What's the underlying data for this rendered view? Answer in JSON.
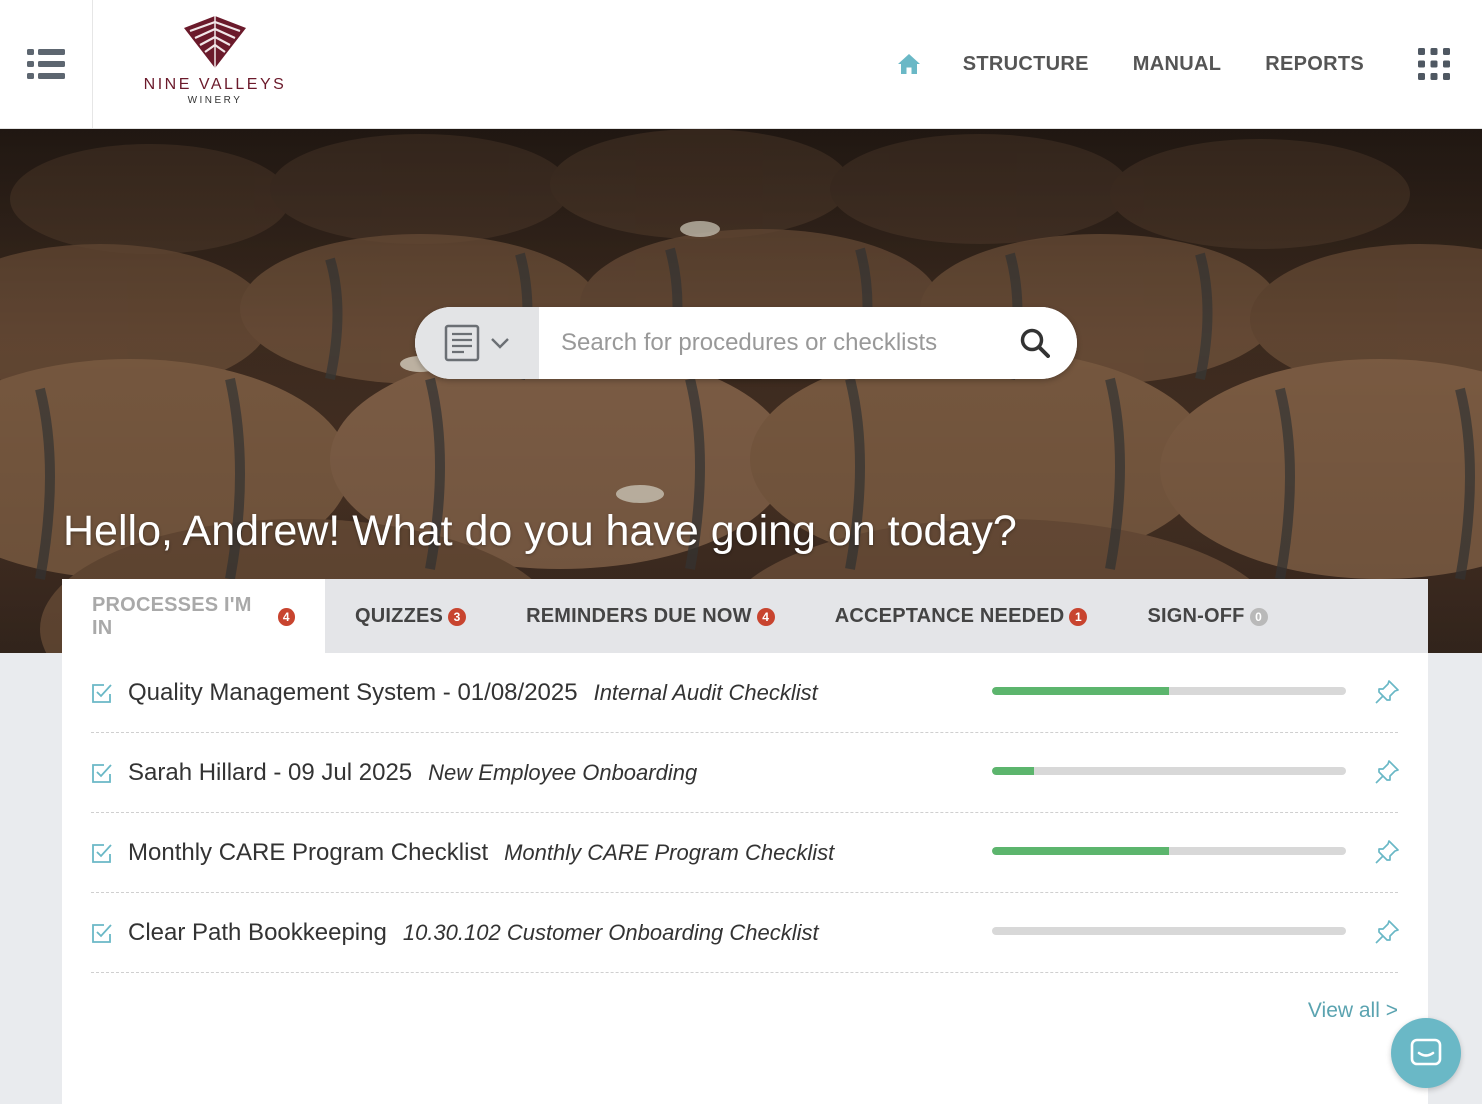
{
  "brand": {
    "name": "NINE VALLEYS",
    "sub": "WINERY",
    "color": "#6b1a2b"
  },
  "nav": {
    "home_icon": "home-icon",
    "items": [
      {
        "label": "STRUCTURE"
      },
      {
        "label": "MANUAL"
      },
      {
        "label": "REPORTS"
      }
    ],
    "apps_icon": "apps-grid-icon",
    "home_color": "#6ab8c6"
  },
  "search": {
    "placeholder": "Search for procedures or checklists",
    "type_icon": "document-icon"
  },
  "greeting": "Hello, Andrew! What do you have going on today?",
  "tabs": [
    {
      "label": "PROCESSES I'M IN",
      "count": "4",
      "active": true
    },
    {
      "label": "QUIZZES",
      "count": "3",
      "active": false
    },
    {
      "label": "REMINDERS DUE NOW",
      "count": "4",
      "active": false
    },
    {
      "label": "ACCEPTANCE NEEDED",
      "count": "1",
      "active": false
    },
    {
      "label": "SIGN-OFF",
      "count": "0",
      "active": false
    }
  ],
  "processes": [
    {
      "title": "Quality Management System - 01/08/2025",
      "checklist": "Internal Audit Checklist",
      "progress": 0.5
    },
    {
      "title": "Sarah Hillard - 09 Jul 2025",
      "checklist": "New Employee Onboarding",
      "progress": 0.12
    },
    {
      "title": "Monthly CARE Program Checklist",
      "checklist": "Monthly CARE Program Checklist",
      "progress": 0.5
    },
    {
      "title": "Clear Path Bookkeeping",
      "checklist": "10.30.102 Customer Onboarding Checklist",
      "progress": 0
    }
  ],
  "view_all": "View all >",
  "colors": {
    "accent": "#6ab8c6",
    "progress": "#5cb56d",
    "badge": "#c8442f"
  }
}
